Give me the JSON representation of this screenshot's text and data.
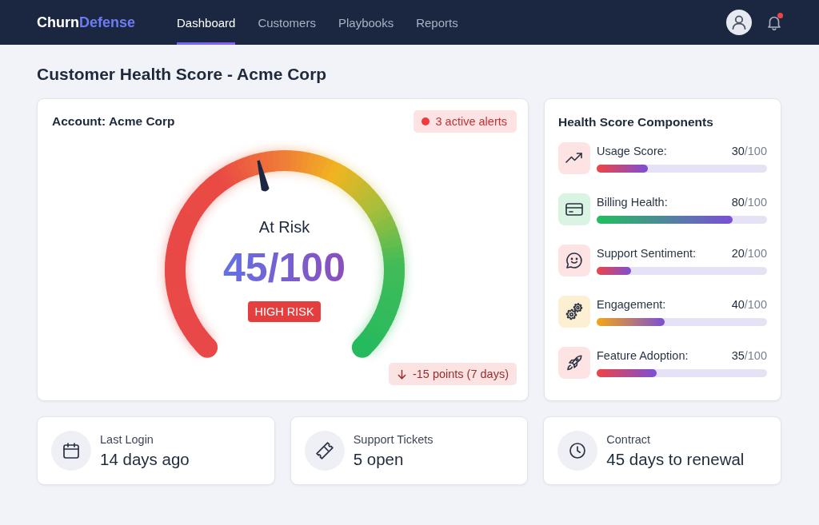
{
  "header": {
    "logo": {
      "primary": "Churn",
      "accent": "Defense"
    },
    "tabs": [
      {
        "label": "Dashboard",
        "selected": true
      },
      {
        "label": "Customers",
        "selected": false
      },
      {
        "label": "Playbooks",
        "selected": false
      },
      {
        "label": "Reports",
        "selected": false
      }
    ],
    "notifications": {
      "unread": true
    }
  },
  "page_title": "Customer Health Score - Acme Corp",
  "account_card": {
    "title": "Account: Acme Corp",
    "alerts": "3 active alerts",
    "gauge": {
      "level": 0.45,
      "status": "At Risk",
      "score": "45/100",
      "risk_badge": "HIGH RISK"
    },
    "trend": {
      "text": "-15 points (7 days)"
    }
  },
  "components_card": {
    "title": "Health Score Components",
    "items": [
      {
        "kind": "danger",
        "label": "Usage Score:",
        "value": "30",
        "out_of": "/100",
        "level": 0.3
      },
      {
        "kind": "success",
        "label": "Billing Health:",
        "value": "80",
        "out_of": "/100",
        "level": 0.8
      },
      {
        "kind": "danger",
        "label": "Support Sentiment:",
        "value": "20",
        "out_of": "/100",
        "level": 0.2
      },
      {
        "kind": "warning",
        "label": "Engagement:",
        "value": "40",
        "out_of": "/100",
        "level": 0.4
      },
      {
        "kind": "danger",
        "label": "Feature Adoption:",
        "value": "35",
        "out_of": "/100",
        "level": 0.35
      }
    ]
  },
  "stats": [
    {
      "label": "Last Login",
      "value": "14 days ago"
    },
    {
      "label": "Support Tickets",
      "value": "5 open"
    },
    {
      "label": "Contract",
      "value": "45 days to renewal"
    }
  ]
}
